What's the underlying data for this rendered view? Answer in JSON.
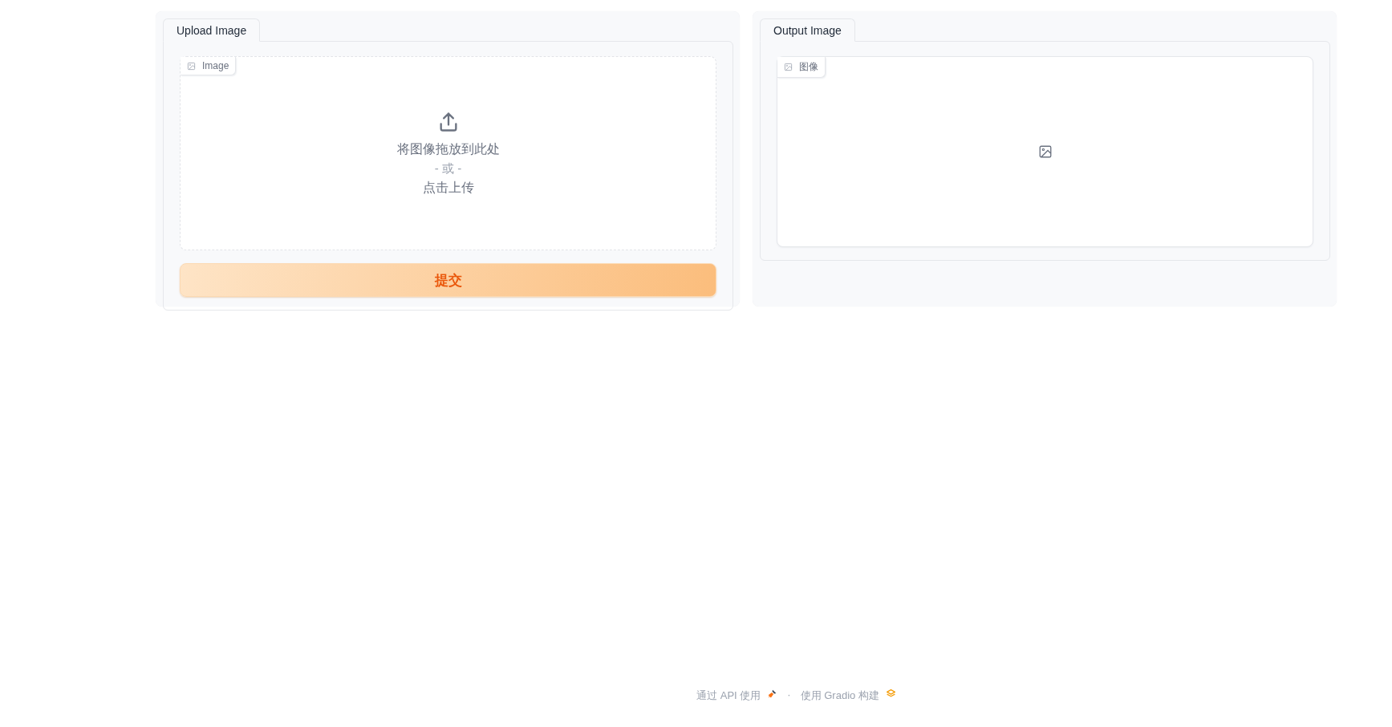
{
  "panels": [
    {
      "tabs": [
        {
          "label": "Upload Image",
          "selected": true
        }
      ],
      "image_field": {
        "kind": "upload",
        "label": "Image",
        "drop_text": "将图像拖放到此处",
        "or_text": "- 或 -",
        "click_text": "点击上传"
      },
      "submit_button": "提交"
    },
    {
      "tabs": [
        {
          "label": "Output Image",
          "selected": true
        }
      ],
      "image_field": {
        "kind": "output",
        "label": "图像"
      }
    }
  ],
  "footer": {
    "api_link": "通过 API 使用",
    "separator": "·",
    "built_with": "使用 Gradio 构建"
  }
}
